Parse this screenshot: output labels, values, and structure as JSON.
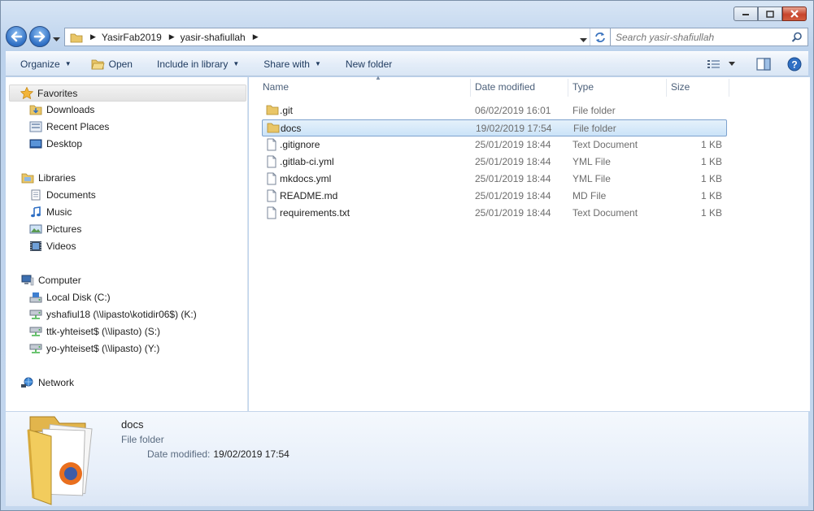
{
  "window": {
    "controls": {
      "minimize": "minimize",
      "maximize": "maximize",
      "close": "close"
    }
  },
  "address": {
    "crumbs": [
      "YasirFab2019",
      "yasir-shafiullah"
    ],
    "search_placeholder": "Search yasir-shafiullah"
  },
  "toolbar": {
    "organize": "Organize",
    "open": "Open",
    "include_in_library": "Include in library",
    "share_with": "Share with",
    "new_folder": "New folder"
  },
  "nav": {
    "favorites": {
      "label": "Favorites",
      "items": [
        "Downloads",
        "Recent Places",
        "Desktop"
      ]
    },
    "libraries": {
      "label": "Libraries",
      "items": [
        "Documents",
        "Music",
        "Pictures",
        "Videos"
      ]
    },
    "computer": {
      "label": "Computer",
      "items": [
        "Local Disk (C:)",
        "yshafiul18 (\\\\lipasto\\kotidir06$) (K:)",
        "ttk-yhteiset$ (\\\\lipasto) (S:)",
        "yo-yhteiset$ (\\\\lipasto) (Y:)"
      ]
    },
    "network": {
      "label": "Network"
    }
  },
  "columns": {
    "name": "Name",
    "date": "Date modified",
    "type": "Type",
    "size": "Size"
  },
  "files": [
    {
      "name": ".git",
      "date": "06/02/2019 16:01",
      "type": "File folder",
      "size": "",
      "icon": "folder-icon"
    },
    {
      "name": "docs",
      "date": "19/02/2019 17:54",
      "type": "File folder",
      "size": "",
      "icon": "folder-icon",
      "selected": true
    },
    {
      "name": ".gitignore",
      "date": "25/01/2019 18:44",
      "type": "Text Document",
      "size": "1 KB",
      "icon": "document-icon"
    },
    {
      "name": ".gitlab-ci.yml",
      "date": "25/01/2019 18:44",
      "type": "YML File",
      "size": "1 KB",
      "icon": "document-icon"
    },
    {
      "name": "mkdocs.yml",
      "date": "25/01/2019 18:44",
      "type": "YML File",
      "size": "1 KB",
      "icon": "document-icon"
    },
    {
      "name": "README.md",
      "date": "25/01/2019 18:44",
      "type": "MD File",
      "size": "1 KB",
      "icon": "document-icon"
    },
    {
      "name": "requirements.txt",
      "date": "25/01/2019 18:44",
      "type": "Text Document",
      "size": "1 KB",
      "icon": "document-icon"
    }
  ],
  "details": {
    "name": "docs",
    "type": "File folder",
    "date_label": "Date modified:",
    "date_value": "19/02/2019 17:54"
  }
}
